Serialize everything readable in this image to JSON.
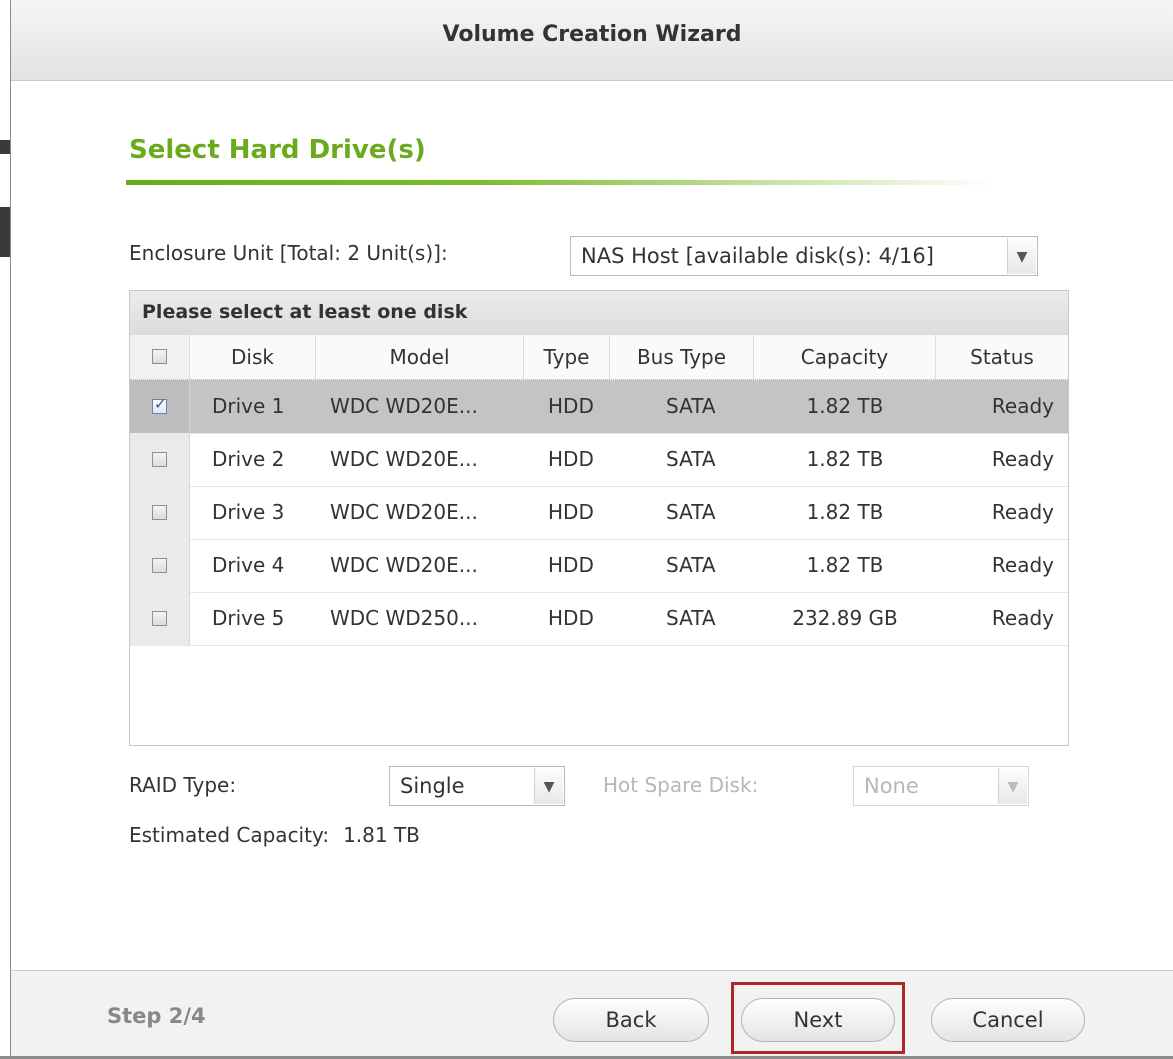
{
  "window": {
    "title": "Volume Creation Wizard"
  },
  "section": {
    "title": "Select Hard Drive(s)"
  },
  "enclosure": {
    "label": "Enclosure Unit [Total: 2 Unit(s)]:",
    "selected": "NAS Host [available disk(s): 4/16]"
  },
  "disk_table": {
    "caption": "Please select at least one disk",
    "columns": [
      "Disk",
      "Model",
      "Type",
      "Bus Type",
      "Capacity",
      "Status"
    ],
    "rows": [
      {
        "disk": "Drive 1",
        "model": "WDC WD20E...",
        "type": "HDD",
        "bus": "SATA",
        "capacity": "1.82 TB",
        "status": "Ready",
        "checked": true
      },
      {
        "disk": "Drive 2",
        "model": "WDC WD20E...",
        "type": "HDD",
        "bus": "SATA",
        "capacity": "1.82 TB",
        "status": "Ready",
        "checked": false
      },
      {
        "disk": "Drive 3",
        "model": "WDC WD20E...",
        "type": "HDD",
        "bus": "SATA",
        "capacity": "1.82 TB",
        "status": "Ready",
        "checked": false
      },
      {
        "disk": "Drive 4",
        "model": "WDC WD20E...",
        "type": "HDD",
        "bus": "SATA",
        "capacity": "1.82 TB",
        "status": "Ready",
        "checked": false
      },
      {
        "disk": "Drive 5",
        "model": "WDC WD250...",
        "type": "HDD",
        "bus": "SATA",
        "capacity": "232.89 GB",
        "status": "Ready",
        "checked": false
      }
    ]
  },
  "raid": {
    "label": "RAID Type:",
    "selected": "Single"
  },
  "hot_spare": {
    "label": "Hot Spare Disk:",
    "selected": "None",
    "disabled": true
  },
  "estimated": {
    "label": "Estimated Capacity:",
    "value": "1.81 TB"
  },
  "footer": {
    "step": "Step 2/4",
    "back": "Back",
    "next": "Next",
    "cancel": "Cancel"
  },
  "icons": {
    "checkbox_checked": "checkmark-icon",
    "dropdown": "chevron-down-icon"
  },
  "colors": {
    "accent": "#6aaa1c",
    "highlight": "#b3242b",
    "selected_row": "#c4c4c4"
  }
}
